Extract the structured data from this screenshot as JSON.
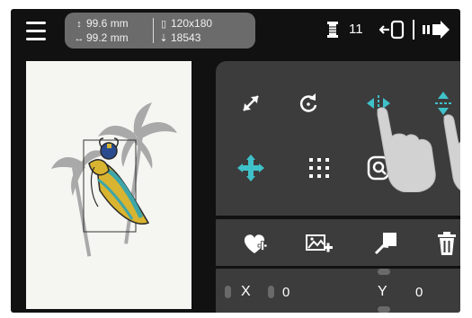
{
  "header": {
    "height_value": "99.6 mm",
    "width_value": "99.2 mm",
    "hoop_size": "120x180",
    "stitch_count": "18543",
    "thread_count": "11"
  },
  "icons": {
    "menu": "hamburger-menu-icon",
    "height": "vertical-arrow-icon",
    "width": "horizontal-arrow-icon",
    "hoop": "hoop-icon",
    "stitches": "needle-icon",
    "thread": "thread-spool-icon",
    "frame": "frame-out-icon",
    "next": "next-arrow-icon"
  },
  "tools": [
    {
      "name": "resize-icon"
    },
    {
      "name": "rotate-icon"
    },
    {
      "name": "mirror-horizontal-icon"
    },
    {
      "name": "mirror-vertical-icon"
    },
    {
      "name": "move-icon"
    },
    {
      "name": "grid-icon"
    },
    {
      "name": "zoom-icon"
    },
    {
      "name": "favorite-add-icon"
    },
    {
      "name": "add-image-icon"
    },
    {
      "name": "apply-icon"
    },
    {
      "name": "delete-icon"
    }
  ],
  "position": {
    "x_label": "X",
    "x_value": "0",
    "y_label": "Y",
    "y_value": "0"
  },
  "colors": {
    "accent": "#3fc1c9",
    "panel": "#3c3c3c",
    "info_panel": "#6b6b6b",
    "background": "#111111"
  }
}
